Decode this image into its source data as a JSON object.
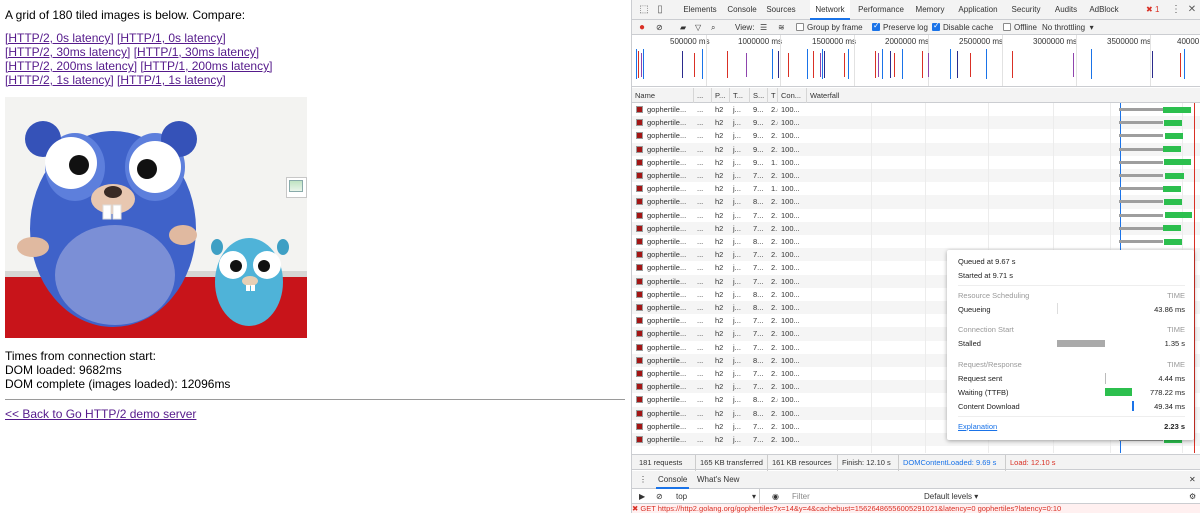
{
  "page": {
    "heading": "A grid of 180 tiled images is below. Compare:",
    "links": [
      [
        "[HTTP/2, 0s latency]",
        "[HTTP/1, 0s latency]"
      ],
      [
        "[HTTP/2, 30ms latency]",
        "[HTTP/1, 30ms latency]"
      ],
      [
        "[HTTP/2, 200ms latency]",
        "[HTTP/1, 200ms latency]"
      ],
      [
        "[HTTP/2, 1s latency]",
        "[HTTP/1, 1s latency]"
      ]
    ],
    "times_title": "Times from connection start:",
    "dom_loaded": "DOM loaded: 9682ms",
    "dom_complete": "DOM complete (images loaded): 12096ms",
    "back_link": "<< Back to Go HTTP/2 demo server"
  },
  "devtools": {
    "tabs": [
      "Elements",
      "Console",
      "Sources",
      "Network",
      "Performance",
      "Memory",
      "Application",
      "Security",
      "Audits",
      "AdBlock"
    ],
    "active_tab": "Network",
    "error_count": "1",
    "toolbar": {
      "view_label": "View:",
      "group_by_frame": "Group by frame",
      "preserve_log": "Preserve log",
      "disable_cache": "Disable cache",
      "offline": "Offline",
      "throttling": "No throttling"
    },
    "overview_ticks": [
      "500000 ms",
      "1000000 ms",
      "1500000 ms",
      "2000000 ms",
      "2500000 ms",
      "3000000 ms",
      "3500000 ms",
      "40000"
    ],
    "columns": [
      "Name",
      "...",
      "P...",
      "T...",
      "S...",
      "T",
      "Con...",
      "Waterfall"
    ],
    "rows": [
      [
        "gophertile...",
        "...",
        "h2",
        "j...",
        "9...",
        "2.(",
        "100..."
      ],
      [
        "gophertile...",
        "...",
        "h2",
        "j...",
        "9...",
        "2.(",
        "100..."
      ],
      [
        "gophertile...",
        "...",
        "h2",
        "j...",
        "9...",
        "2.:",
        "100..."
      ],
      [
        "gophertile...",
        "...",
        "h2",
        "j...",
        "9...",
        "2.:",
        "100..."
      ],
      [
        "gophertile...",
        "...",
        "h2",
        "j...",
        "9...",
        "1.!",
        "100..."
      ],
      [
        "gophertile...",
        "...",
        "h2",
        "j...",
        "7...",
        "2.:",
        "100..."
      ],
      [
        "gophertile...",
        "...",
        "h2",
        "j...",
        "7...",
        "1.!",
        "100..."
      ],
      [
        "gophertile...",
        "...",
        "h2",
        "j...",
        "8...",
        "2.:",
        "100..."
      ],
      [
        "gophertile...",
        "...",
        "h2",
        "j...",
        "7...",
        "2.:",
        "100..."
      ],
      [
        "gophertile...",
        "...",
        "h2",
        "j...",
        "7...",
        "2.",
        "100..."
      ],
      [
        "gophertile...",
        "...",
        "h2",
        "j...",
        "8...",
        "2.:",
        "100..."
      ],
      [
        "gophertile...",
        "...",
        "h2",
        "j...",
        "7...",
        "2.",
        "100..."
      ],
      [
        "gophertile...",
        "...",
        "h2",
        "j...",
        "7...",
        "2.",
        "100..."
      ],
      [
        "gophertile...",
        "...",
        "h2",
        "j...",
        "7...",
        "2.",
        "100..."
      ],
      [
        "gophertile...",
        "...",
        "h2",
        "j...",
        "8...",
        "2.",
        "100..."
      ],
      [
        "gophertile...",
        "...",
        "h2",
        "j...",
        "8...",
        "2.",
        "100..."
      ],
      [
        "gophertile...",
        "...",
        "h2",
        "j...",
        "7...",
        "2.",
        "100..."
      ],
      [
        "gophertile...",
        "...",
        "h2",
        "j...",
        "7...",
        "2.:",
        "100..."
      ],
      [
        "gophertile...",
        "...",
        "h2",
        "j...",
        "7...",
        "2.",
        "100..."
      ],
      [
        "gophertile...",
        "...",
        "h2",
        "j...",
        "8...",
        "2.",
        "100..."
      ],
      [
        "gophertile...",
        "...",
        "h2",
        "j...",
        "7...",
        "2.:",
        "100..."
      ],
      [
        "gophertile...",
        "...",
        "h2",
        "j...",
        "7...",
        "2.",
        "100..."
      ],
      [
        "gophertile...",
        "...",
        "h2",
        "j...",
        "8...",
        "2.(",
        "100..."
      ],
      [
        "gophertile...",
        "...",
        "h2",
        "j...",
        "8...",
        "2.",
        "100..."
      ],
      [
        "gophertile...",
        "...",
        "h2",
        "j...",
        "7...",
        "2.:",
        "100..."
      ],
      [
        "gophertile...",
        "...",
        "h2",
        "j...",
        "7...",
        "2.",
        "100..."
      ]
    ],
    "summary": {
      "requests": "181 requests",
      "transferred": "165 KB transferred",
      "resources": "161 KB resources",
      "finish": "Finish: 12.10 s",
      "dcl": "DOMContentLoaded: 9.69 s",
      "load": "Load: 12.10 s"
    },
    "drawer": {
      "tabs": [
        "Console",
        "What's New"
      ],
      "context": "top",
      "filter_placeholder": "Filter",
      "levels": "Default levels ▾",
      "error_line": "GET https://http2.golang.org/gophertiles?x=14&y=4&cachebust=15626486556005291021&latency=0    gophertiles?latency=0:10"
    },
    "tooltip": {
      "queued": "Queued at 9.67 s",
      "started": "Started at 9.71 s",
      "sched_header": "Resource Scheduling",
      "time_label": "TIME",
      "queueing": "Queueing",
      "queueing_time": "43.86 ms",
      "conn_header": "Connection Start",
      "stalled": "Stalled",
      "stalled_time": "1.35 s",
      "req_header": "Request/Response",
      "request_sent": "Request sent",
      "request_sent_time": "4.44 ms",
      "waiting": "Waiting (TTFB)",
      "waiting_time": "778.22 ms",
      "content": "Content Download",
      "content_time": "49.34 ms",
      "explanation": "Explanation",
      "total": "2.23 s"
    }
  }
}
